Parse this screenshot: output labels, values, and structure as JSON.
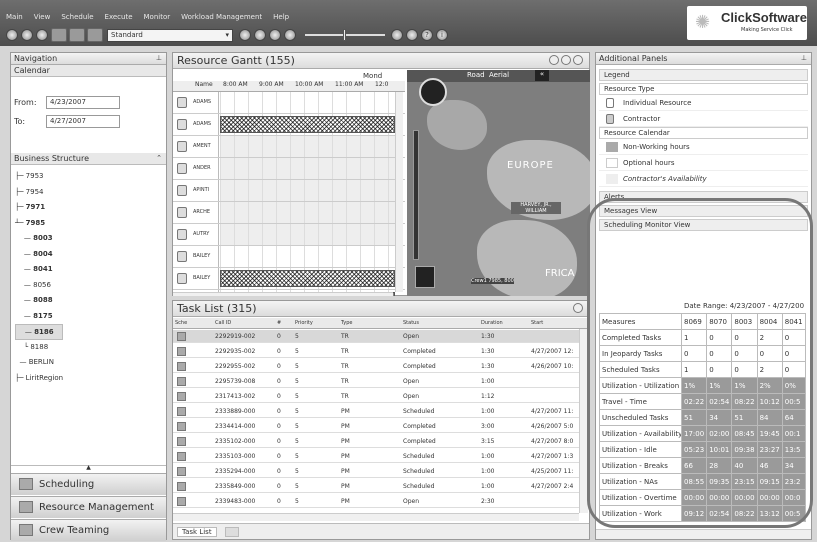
{
  "menu": [
    "Main",
    "View",
    "Schedule",
    "Execute",
    "Monitor",
    "Workload Management",
    "Help"
  ],
  "toolbar": {
    "dropdown": "Standard"
  },
  "logo": {
    "name": "ClickSoftware",
    "tagline": "Making Service Click"
  },
  "nav": {
    "title": "Navigation",
    "calendar": "Calendar",
    "from_label": "From:",
    "from": "4/23/2007",
    "to_label": "To:",
    "to": "4/27/2007",
    "business": "Business Structure",
    "tree": [
      "7953",
      "7954",
      "7971",
      "7985",
      "8003",
      "8004",
      "8041",
      "8056",
      "8088",
      "8175",
      "8186",
      "8188",
      "BERLIN",
      "LiritRegion"
    ],
    "buttons": [
      "Scheduling",
      "Resource Management",
      "Crew Teaming"
    ]
  },
  "gantt": {
    "title": "Resource Gantt (155)",
    "day": "Mond",
    "name_hdr": "Name",
    "times": [
      "8:00 AM",
      "9:00 AM",
      "10:00 AM",
      "11:00 AM",
      "12:0"
    ],
    "rows": [
      "ADAMS",
      "ADAMS",
      "AMENT",
      "ANDER",
      "APINTI",
      "ARCHE",
      "AUTRY",
      "BAILEY",
      "BAILEY",
      "BAILEY"
    ],
    "map": {
      "road": "Road",
      "aerial": "Aerial",
      "europe": "EUROPE",
      "africa": "FRICA",
      "pin1": "HARVEY, JR., WILLIAM",
      "pin2": "Crew1 7985, 800"
    }
  },
  "tasks": {
    "title": "Task List (315)",
    "cols": [
      "Sche",
      "Call ID",
      "#",
      "Priority",
      "Type",
      "Status",
      "Duration",
      "Start"
    ],
    "rows": [
      [
        "2292919-002",
        "0",
        "5",
        "TR",
        "Open",
        "1:30",
        ""
      ],
      [
        "2292935-002",
        "0",
        "5",
        "TR",
        "Completed",
        "1:30",
        "4/27/2007 12:"
      ],
      [
        "2292955-002",
        "0",
        "5",
        "TR",
        "Completed",
        "1:30",
        "4/26/2007 10:"
      ],
      [
        "2295739-008",
        "0",
        "5",
        "TR",
        "Open",
        "1:00",
        ""
      ],
      [
        "2317413-002",
        "0",
        "5",
        "TR",
        "Open",
        "1:12",
        ""
      ],
      [
        "2333889-000",
        "0",
        "5",
        "PM",
        "Scheduled",
        "1:00",
        "4/27/2007 11:"
      ],
      [
        "2334414-000",
        "0",
        "5",
        "PM",
        "Completed",
        "3:00",
        "4/26/2007 5:0"
      ],
      [
        "2335102-000",
        "0",
        "5",
        "PM",
        "Completed",
        "3:15",
        "4/27/2007 8:0"
      ],
      [
        "2335103-000",
        "0",
        "5",
        "PM",
        "Scheduled",
        "1:00",
        "4/27/2007 1:3"
      ],
      [
        "2335294-000",
        "0",
        "5",
        "PM",
        "Scheduled",
        "1:00",
        "4/25/2007 11:"
      ],
      [
        "2335849-000",
        "0",
        "5",
        "PM",
        "Scheduled",
        "1:00",
        "4/27/2007 2:4"
      ],
      [
        "2339483-000",
        "0",
        "5",
        "PM",
        "Open",
        "2:30",
        ""
      ]
    ],
    "tab": "Task List"
  },
  "additional": {
    "title": "Additional Panels",
    "legend": "Legend",
    "resource_type": "Resource Type",
    "individual": "Individual Resource",
    "contractor": "Contractor",
    "resource_calendar": "Resource Calendar",
    "nonworking": "Non-Working hours",
    "optional": "Optional hours",
    "availability": "Contractor's Availability",
    "alerts": "Alerts",
    "messages": "Messages View",
    "scheduling": "Scheduling Monitor View",
    "date_range": "Date Range: 4/23/2007 - 4/27/200",
    "measures_hdr": "Measures",
    "cols": [
      "8069",
      "8070",
      "8003",
      "8004",
      "8041"
    ],
    "measures": [
      {
        "name": "Completed Tasks",
        "vals": [
          "1",
          "0",
          "0",
          "2",
          "0"
        ],
        "dark": false
      },
      {
        "name": "In Jeopardy Tasks",
        "vals": [
          "0",
          "0",
          "0",
          "0",
          "0"
        ],
        "dark": false
      },
      {
        "name": "Scheduled Tasks",
        "vals": [
          "1",
          "0",
          "0",
          "2",
          "0"
        ],
        "dark": false
      },
      {
        "name": "Utilization - Utilization",
        "vals": [
          "1%",
          "1%",
          "1%",
          "2%",
          "0%"
        ],
        "dark": true
      },
      {
        "name": "Travel - Time",
        "vals": [
          "02:22",
          "02:54",
          "08:22",
          "10:12",
          "00:5"
        ],
        "dark": true
      },
      {
        "name": "Unscheduled Tasks",
        "vals": [
          "51",
          "34",
          "51",
          "84",
          "64"
        ],
        "dark": true
      },
      {
        "name": "Utilization - Availability",
        "vals": [
          "17:00",
          "02:00",
          "08:45",
          "19:45",
          "00:1"
        ],
        "dark": true
      },
      {
        "name": "Utilization - Idle",
        "vals": [
          "05:23",
          "10:01",
          "09:38",
          "23:27",
          "13:5"
        ],
        "dark": true
      },
      {
        "name": "Utilization - Breaks",
        "vals": [
          "66",
          "28",
          "40",
          "46",
          "34"
        ],
        "dark": true
      },
      {
        "name": "Utilization - NAs",
        "vals": [
          "08:55",
          "09:35",
          "23:15",
          "09:15",
          "23:2"
        ],
        "dark": true
      },
      {
        "name": "Utilization - Overtime",
        "vals": [
          "00:00",
          "00:00",
          "00:00",
          "00:00",
          "00:0"
        ],
        "dark": true
      },
      {
        "name": "Utilization - Work",
        "vals": [
          "09:12",
          "02:54",
          "08:22",
          "13:12",
          "00:5"
        ],
        "dark": true
      }
    ]
  }
}
